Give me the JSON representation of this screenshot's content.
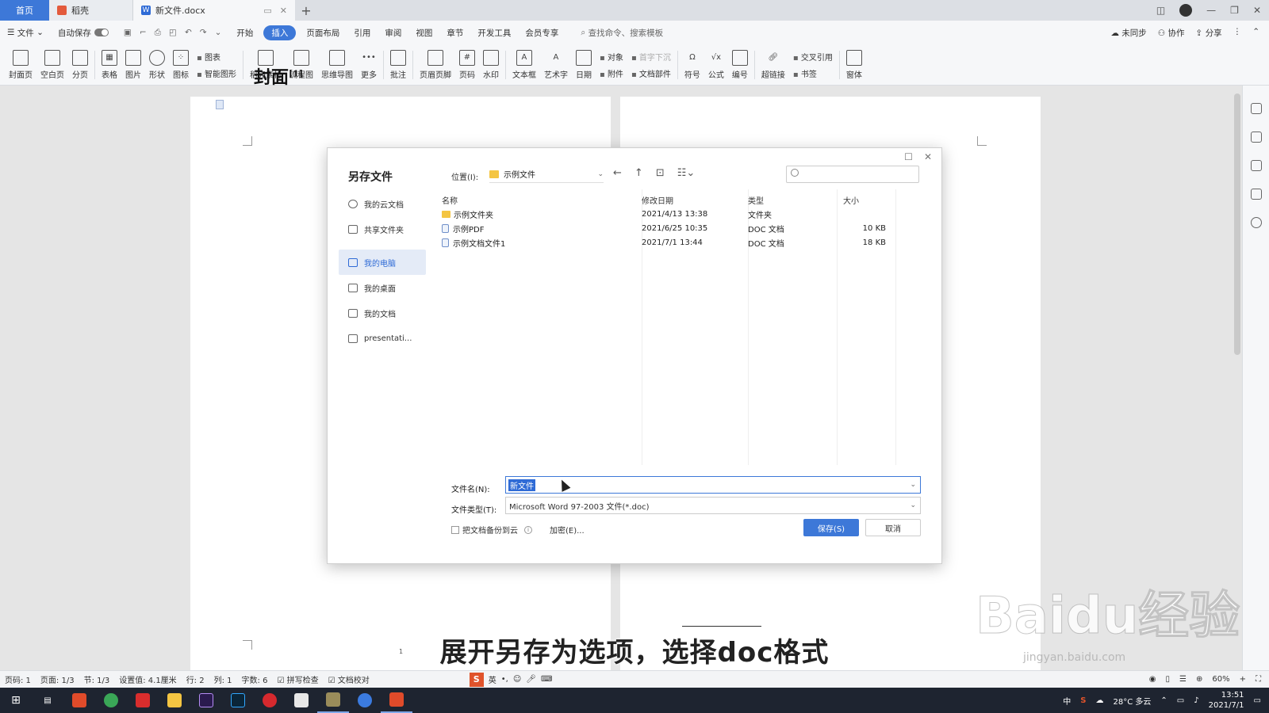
{
  "tabs": {
    "home": "首页",
    "daoke": "稻壳",
    "doc": "新文件.docx",
    "plus": "+"
  },
  "menubar": {
    "file": "文件",
    "autosave": "自动保存",
    "items": [
      "开始",
      "插入",
      "页面布局",
      "引用",
      "审阅",
      "视图",
      "章节",
      "开发工具",
      "会员专享"
    ],
    "active": "插入",
    "search": "查找命令、搜索模板",
    "sync": "未同步",
    "collab": "协作",
    "share": "分享"
  },
  "ribbon": {
    "groups": [
      "封面页",
      "空白页",
      "分页",
      "表格",
      "图片",
      "形状",
      "图标"
    ],
    "pair1": [
      "图表",
      "智能图形"
    ],
    "groups2": [
      "稻壳素材",
      "流程图",
      "思维导图",
      "更多",
      "批注",
      "页眉页脚",
      "页码",
      "水印",
      "文本框",
      "艺术字",
      "日期"
    ],
    "pair2": [
      "对象",
      "附件"
    ],
    "pair3": [
      "首字下沉",
      "文档部件"
    ],
    "groups3": [
      "符号",
      "公式",
      "编号",
      "超链接"
    ],
    "pair4": [
      "交叉引用",
      "书签"
    ],
    "groups4": [
      "窗体"
    ]
  },
  "document": {
    "cover_title": "封面",
    "cover_sup": "[1]",
    "page_number": "1"
  },
  "dialog": {
    "title": "另存文件",
    "location_label": "位置(I):",
    "location_value": "示例文件",
    "sidebar": [
      {
        "label": "我的云文档"
      },
      {
        "label": "共享文件夹"
      },
      {
        "label": "我的电脑"
      },
      {
        "label": "我的桌面"
      },
      {
        "label": "我的文档"
      },
      {
        "label": "presentati..."
      }
    ],
    "columns": {
      "name": "名称",
      "date": "修改日期",
      "type": "类型",
      "size": "大小"
    },
    "files": [
      {
        "name": "示例文件夹",
        "date": "2021/4/13 13:38",
        "type": "文件夹",
        "size": "",
        "kind": "folder"
      },
      {
        "name": "示例PDF",
        "date": "2021/6/25 10:35",
        "type": "DOC 文档",
        "size": "10 KB",
        "kind": "doc"
      },
      {
        "name": "示例文档文件1",
        "date": "2021/7/1 13:44",
        "type": "DOC 文档",
        "size": "18 KB",
        "kind": "doc"
      }
    ],
    "filename_label": "文件名(N):",
    "filename_value": "新文件",
    "filetype_label": "文件类型(T):",
    "filetype_value": "Microsoft Word 97-2003 文件(*.doc)",
    "backup_label": "把文档备份到云",
    "encrypt_label": "加密(E)...",
    "save_button": "保存(S)",
    "cancel_button": "取消"
  },
  "subtitle": "展开另存为选项，选择doc格式",
  "watermark": "Baidu经验",
  "watermark_url": "jingyan.baidu.com",
  "statusbar": {
    "page_code": "页码: 1",
    "pages": "页面: 1/3",
    "section": "节: 1/3",
    "setting": "设置值: 4.1厘米",
    "row": "行: 2",
    "col": "列: 1",
    "words": "字数: 6",
    "spell": "拼写检查",
    "proof": "文档校对",
    "ime_lang": "英",
    "zoom": "60%"
  },
  "taskbar": {
    "weather": "28°C 多云",
    "time": "13:51",
    "date": "2021/7/1",
    "ime": "中"
  },
  "colors": {
    "accent": "#3d78d8",
    "taskbar": "#1e2430",
    "folder": "#f4c542"
  }
}
